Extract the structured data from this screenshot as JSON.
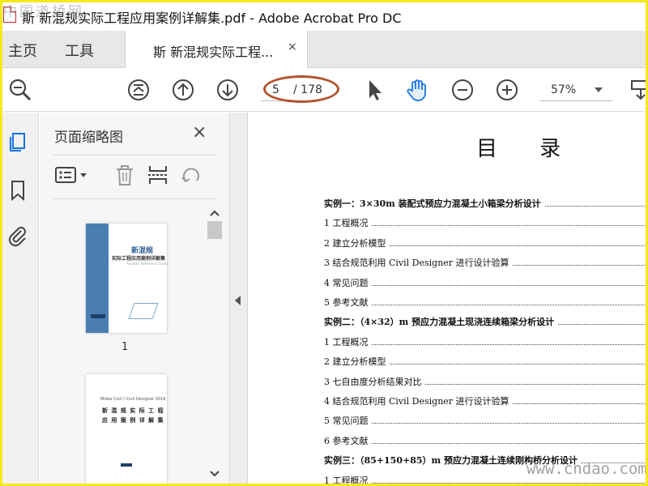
{
  "window": {
    "title": "斯 新混规实际工程应用案例详解集.pdf - Adobe Acrobat Pro DC"
  },
  "tabs": {
    "home": "主页",
    "tools": "工具",
    "document": "斯 新混规实际工程...",
    "close": "×"
  },
  "toolbar": {
    "current_page": "5",
    "total_pages": "/ 178",
    "zoom": "57%"
  },
  "thumbnails_panel": {
    "title": "页面缩略图",
    "close": "×",
    "pages": [
      {
        "number": "1",
        "cover_title": "新混规",
        "cover_subtitle": "实际工程应用案例详解集",
        "cover_small": "Analysis Reference Guide"
      },
      {
        "cover_line1": "Midas Civil / Civil Designer 2016",
        "cover_line2": "新 混 规 实 际 工 程",
        "cover_line3": "应 用 案 例 详 解 集"
      }
    ]
  },
  "document": {
    "title": "目 录",
    "toc": [
      {
        "text": "实例一：3×30m 装配式预应力混凝土小箱梁分析设计",
        "section": true
      },
      {
        "text": "1 工程概况",
        "section": false
      },
      {
        "text": "2 建立分析模型",
        "section": false
      },
      {
        "text": "3 结合规范利用 Civil Designer 进行设计验算",
        "section": false
      },
      {
        "text": "4 常见问题",
        "section": false
      },
      {
        "text": "5 参考文献",
        "section": false
      },
      {
        "text": "实例二：（4×32）m 预应力混凝土现浇连续箱梁分析设计",
        "section": true
      },
      {
        "text": "1 工程概况",
        "section": false
      },
      {
        "text": "2 建立分析模型",
        "section": false
      },
      {
        "text": "3 七自由度分析结果对比",
        "section": false
      },
      {
        "text": "4 结合规范利用 Civil Designer 进行设计验算",
        "section": false
      },
      {
        "text": "5 常见问题",
        "section": false
      },
      {
        "text": "6 参考文献",
        "section": false
      },
      {
        "text": "实例三：（85+150+85）m 预应力混凝土连续刚构桥分析设计",
        "section": true
      },
      {
        "text": "1 工程概况",
        "section": false
      }
    ]
  },
  "watermarks": {
    "top_left": "中国道桥网",
    "bottom_right": "www.cndao.com"
  },
  "colors": {
    "frame": "#f4ea1a",
    "annotation_oval": "#b5532a",
    "cover_blue": "#4a7eb3"
  }
}
